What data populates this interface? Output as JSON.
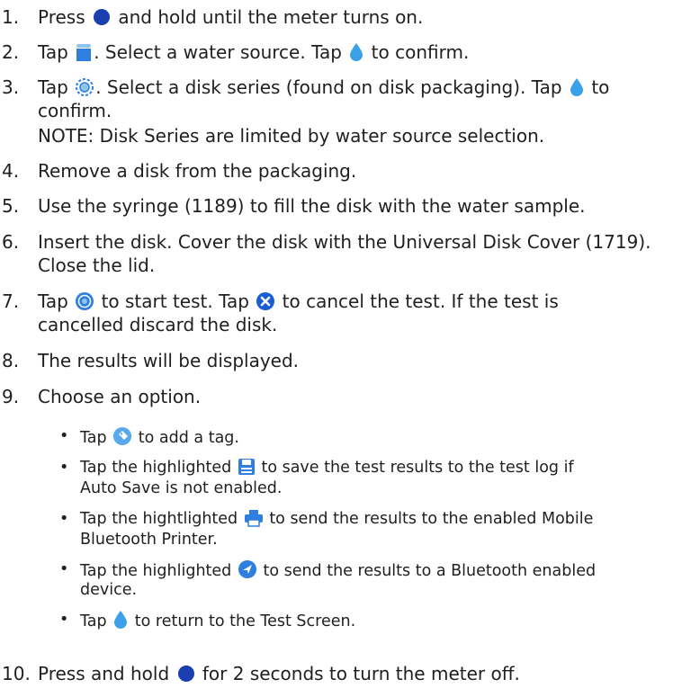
{
  "steps": [
    {
      "num": "1.",
      "a": "Press",
      "b": "and hold until the meter turns on."
    },
    {
      "num": "2.",
      "a": "Tap",
      "b": ". Select a water source. Tap",
      "c": "to confirm."
    },
    {
      "num": "3.",
      "a": "Tap",
      "b": ". Select a disk series (found on disk packaging). Tap",
      "c": "to",
      "d": "confirm.",
      "note": "NOTE: Disk Series are limited by water source selection."
    },
    {
      "num": "4.",
      "a": "Remove a disk from the packaging."
    },
    {
      "num": "5.",
      "a": "Use the syringe (1189) to fill the disk with the water sample."
    },
    {
      "num": "6.",
      "a": "Insert the disk. Cover the disk with the Universal Disk Cover (1719).",
      "b": "Close the lid."
    },
    {
      "num": "7.",
      "a": "Tap",
      "b": "to start test. Tap",
      "c": "to cancel the test. If the test is",
      "d": "cancelled discard the disk."
    },
    {
      "num": "8.",
      "a": "The results will be displayed."
    },
    {
      "num": "9.",
      "a": "Choose an option."
    },
    {
      "num": "10.",
      "a": "Press and hold",
      "b": "for 2 seconds to turn the meter off."
    }
  ],
  "bullets": [
    {
      "dot": "•",
      "a": "Tap",
      "b": "to add a tag."
    },
    {
      "dot": "•",
      "a": "Tap the highlighted",
      "b": "to save the test results to the test log if",
      "c": "Auto Save is not enabled."
    },
    {
      "dot": "•",
      "a": "Tap the hightlighted",
      "b": "to send the results to the enabled Mobile",
      "c": "Bluetooth Printer."
    },
    {
      "dot": "•",
      "a": "Tap the highlighted",
      "b": "to send the results to a Bluetooth enabled",
      "c": "device."
    },
    {
      "dot": "•",
      "a": "Tap",
      "b": "to return to the Test Screen."
    }
  ],
  "colors": {
    "text": "#1f1f1f",
    "power": "#1a3fb0",
    "drop": "#3aa0e8",
    "cancel": "#1a5fd0",
    "icon": "#2f7fe0"
  }
}
